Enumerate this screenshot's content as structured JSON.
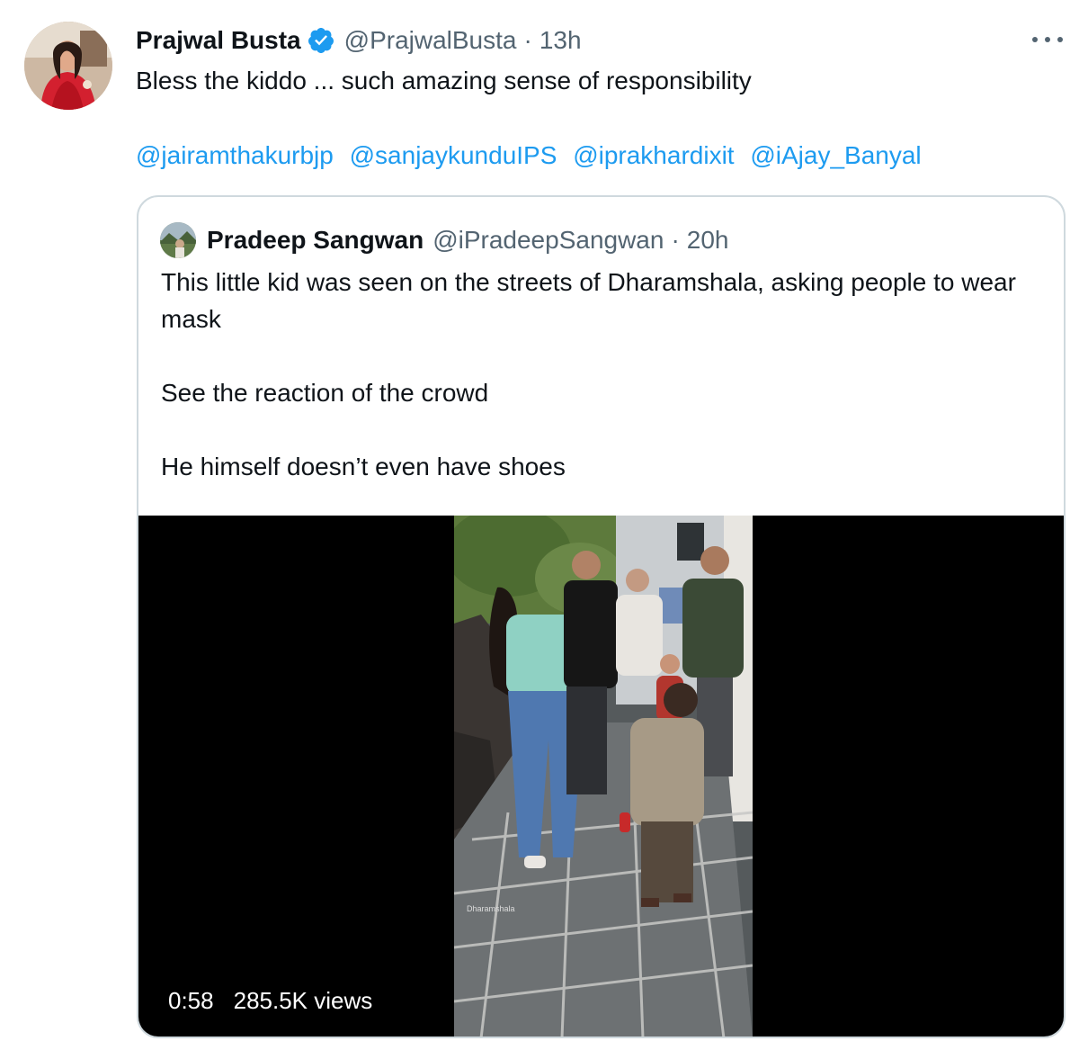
{
  "tweet": {
    "author_name": "Prajwal Busta",
    "author_handle": "@PrajwalBusta",
    "separator": "·",
    "time": "13h",
    "text": "Bless the kiddo ... such amazing sense of responsibility",
    "mentions": [
      "@jairamthakurbjp",
      "@sanjaykunduIPS",
      "@iprakhardixit",
      "@iAjay_Banyal"
    ],
    "avatar_icon": "profile-photo",
    "verified_icon": "verified-badge-icon",
    "more_icon": "more-options-icon"
  },
  "quoted_tweet": {
    "author_name": "Pradeep Sangwan",
    "author_handle": "@iPradeepSangwan",
    "separator": "·",
    "time": "20h",
    "paragraphs": [
      "This little kid was seen on the streets of Dharamshala, asking people to wear mask",
      "See the reaction of the crowd",
      "He himself doesn’t even have shoes"
    ],
    "video": {
      "duration": "0:58",
      "views": "285.5K views",
      "watermark": "Dharamshala"
    }
  },
  "colors": {
    "text": "#0f1419",
    "secondary": "#536471",
    "link": "#1d9bf0",
    "border": "#cfd9de",
    "video_bg": "#000000"
  }
}
